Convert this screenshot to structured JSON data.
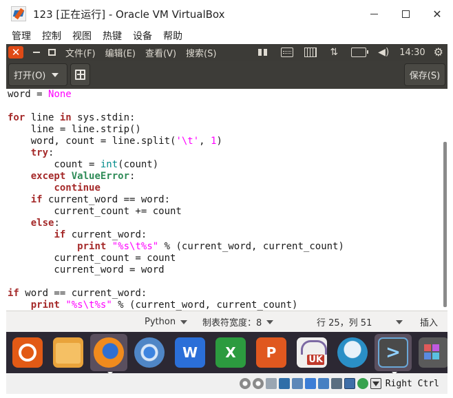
{
  "window": {
    "title": "123 [正在运行] - Oracle VM VirtualBox",
    "icon": "virtualbox-icon"
  },
  "vbox_menu": [
    "管理",
    "控制",
    "视图",
    "热键",
    "设备",
    "帮助"
  ],
  "panel": {
    "menus": [
      "文件(F)",
      "编辑(E)",
      "查看(V)",
      "搜索(S)"
    ],
    "clock": "14:30"
  },
  "gedit": {
    "open_label": "打开(O)",
    "save_label": "保存(S)"
  },
  "code_lines": [
    [
      {
        "t": "word = "
      },
      {
        "t": "None",
        "c": "con"
      }
    ],
    [],
    [
      {
        "t": "for",
        "c": "kw"
      },
      {
        "t": " line "
      },
      {
        "t": "in",
        "c": "kw"
      },
      {
        "t": " sys.stdin:"
      }
    ],
    [
      {
        "t": "    line = line.strip()"
      }
    ],
    [
      {
        "t": "    word, count = line.split("
      },
      {
        "t": "'\\t'",
        "c": "str"
      },
      {
        "t": ", "
      },
      {
        "t": "1",
        "c": "num"
      },
      {
        "t": ")"
      }
    ],
    [
      {
        "t": "    "
      },
      {
        "t": "try",
        "c": "kw"
      },
      {
        "t": ":"
      }
    ],
    [
      {
        "t": "        count = "
      },
      {
        "t": "int",
        "c": "bi"
      },
      {
        "t": "(count)"
      }
    ],
    [
      {
        "t": "    "
      },
      {
        "t": "except",
        "c": "kw"
      },
      {
        "t": " "
      },
      {
        "t": "ValueError",
        "c": "exc"
      },
      {
        "t": ":"
      }
    ],
    [
      {
        "t": "        "
      },
      {
        "t": "continue",
        "c": "kw"
      }
    ],
    [
      {
        "t": "    "
      },
      {
        "t": "if",
        "c": "kw"
      },
      {
        "t": " current_word == word:"
      }
    ],
    [
      {
        "t": "        current_count += count"
      }
    ],
    [
      {
        "t": "    "
      },
      {
        "t": "else",
        "c": "kw"
      },
      {
        "t": ":"
      }
    ],
    [
      {
        "t": "        "
      },
      {
        "t": "if",
        "c": "kw"
      },
      {
        "t": " current_word:"
      }
    ],
    [
      {
        "t": "            "
      },
      {
        "t": "print",
        "c": "kw"
      },
      {
        "t": " "
      },
      {
        "t": "\"%s\\t%s\"",
        "c": "str"
      },
      {
        "t": " % (current_word, current_count)"
      }
    ],
    [
      {
        "t": "        current_count = count"
      }
    ],
    [
      {
        "t": "        current_word = word"
      }
    ],
    [],
    [
      {
        "t": "if",
        "c": "kw"
      },
      {
        "t": " word == current_word:"
      }
    ],
    [
      {
        "t": "    "
      },
      {
        "t": "print",
        "c": "kw"
      },
      {
        "t": " "
      },
      {
        "t": "\"%s\\t%s\"",
        "c": "str"
      },
      {
        "t": " % (current_word, current_count)"
      }
    ]
  ],
  "statusbar": {
    "language": "Python",
    "tab_width": "制表符宽度：8",
    "position": "行 25，列 51",
    "mode": "插入"
  },
  "dock": [
    {
      "name": "ubuntu-dash",
      "cls": "t-ubuntu",
      "label": ""
    },
    {
      "name": "files-app",
      "cls": "t-files",
      "label": ""
    },
    {
      "name": "firefox-app",
      "cls": "t-firefox",
      "label": "",
      "active": true
    },
    {
      "name": "chromium-app",
      "cls": "t-chromium",
      "label": ""
    },
    {
      "name": "writer-app",
      "cls": "t-writer",
      "label": "W"
    },
    {
      "name": "calc-app",
      "cls": "t-calc",
      "label": "X"
    },
    {
      "name": "impress-app",
      "cls": "t-impress",
      "label": "P"
    },
    {
      "name": "software-center-app",
      "cls": "t-store",
      "label": "UK"
    },
    {
      "name": "amazon-app",
      "cls": "t-amazon",
      "label": ""
    },
    {
      "name": "gedit-app",
      "cls": "t-vscode",
      "label": ">",
      "active": true
    },
    {
      "name": "more-apps",
      "cls": "t-more",
      "label": ""
    }
  ],
  "vbox_status": {
    "host_key": "Right Ctrl"
  }
}
